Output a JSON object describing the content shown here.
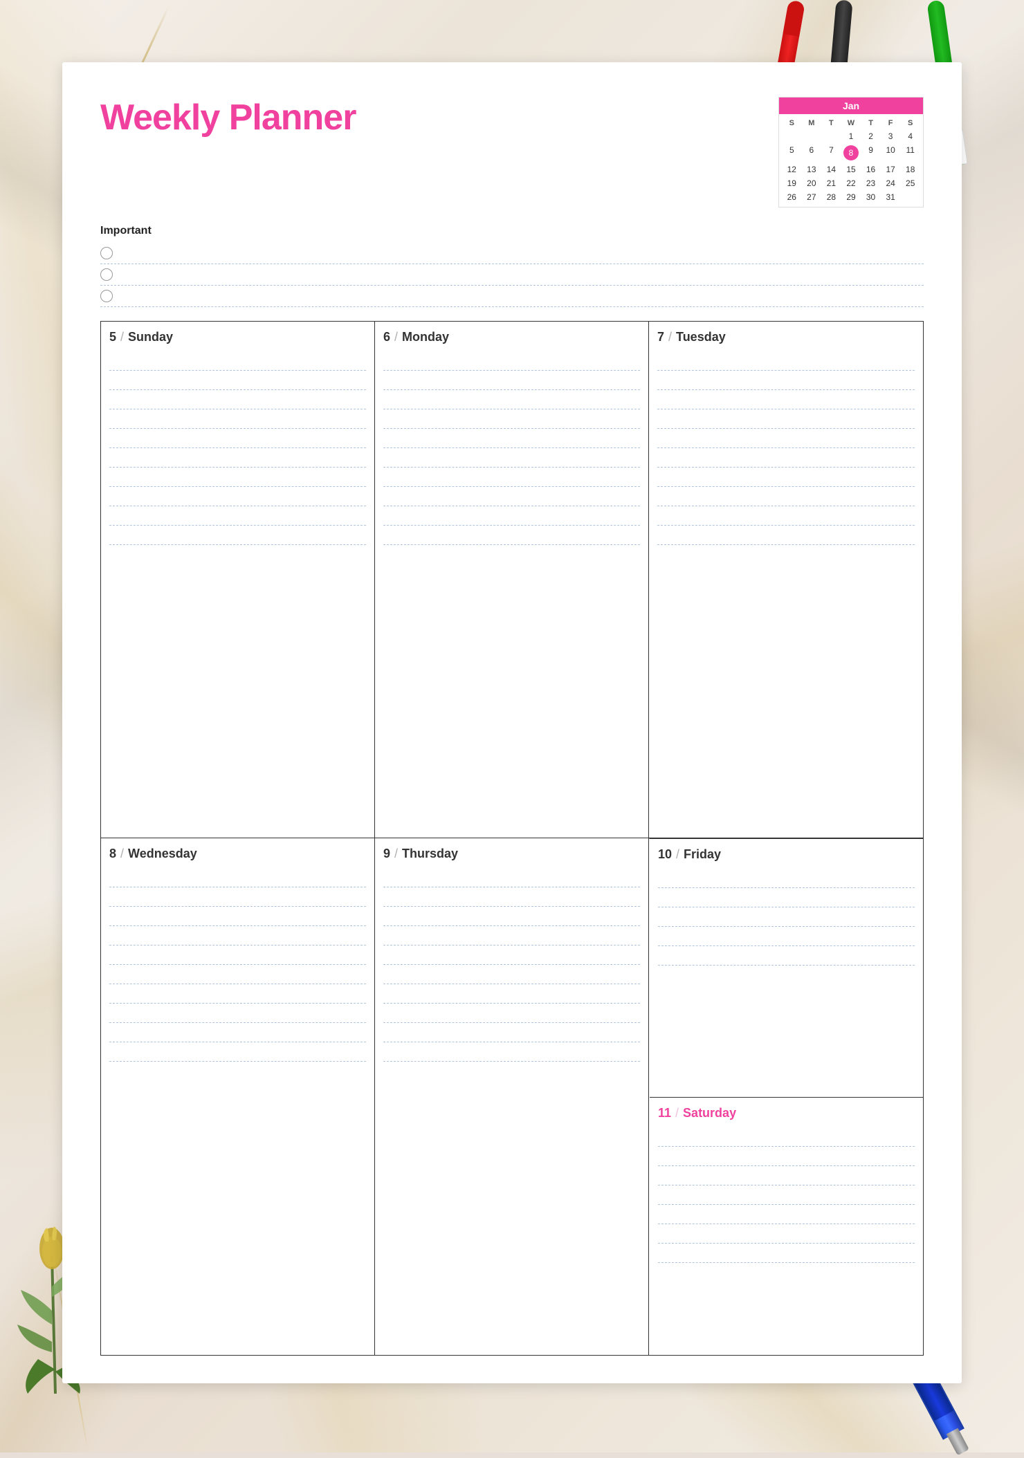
{
  "page": {
    "title": "Weekly Planner",
    "background_color": "#f0ece5"
  },
  "calendar": {
    "month": "Jan",
    "headers": [
      "S",
      "M",
      "T",
      "W",
      "T",
      "F",
      "S"
    ],
    "weeks": [
      [
        "",
        "",
        "",
        "1",
        "2",
        "3",
        "4"
      ],
      [
        "5",
        "6",
        "7",
        "8",
        "9",
        "10",
        "11"
      ],
      [
        "12",
        "13",
        "14",
        "15",
        "16",
        "17",
        "18"
      ],
      [
        "19",
        "20",
        "21",
        "22",
        "23",
        "24",
        "25"
      ],
      [
        "26",
        "27",
        "28",
        "29",
        "30",
        "31",
        ""
      ]
    ],
    "today": "8"
  },
  "important": {
    "label": "Important",
    "items": [
      "",
      "",
      ""
    ]
  },
  "days": [
    {
      "number": "5",
      "name": "Sunday",
      "special": false
    },
    {
      "number": "6",
      "name": "Monday",
      "special": false
    },
    {
      "number": "7",
      "name": "Tuesday",
      "special": false
    },
    {
      "number": "8",
      "name": "Wednesday",
      "special": false
    },
    {
      "number": "9",
      "name": "Thursday",
      "special": false
    },
    {
      "number": "10",
      "name": "Friday",
      "special": false
    },
    {
      "number": "11",
      "name": "Saturday",
      "special": true
    }
  ],
  "slash": "/",
  "lines_per_day": 10,
  "lines_per_friday": 5,
  "lines_per_saturday": 7
}
